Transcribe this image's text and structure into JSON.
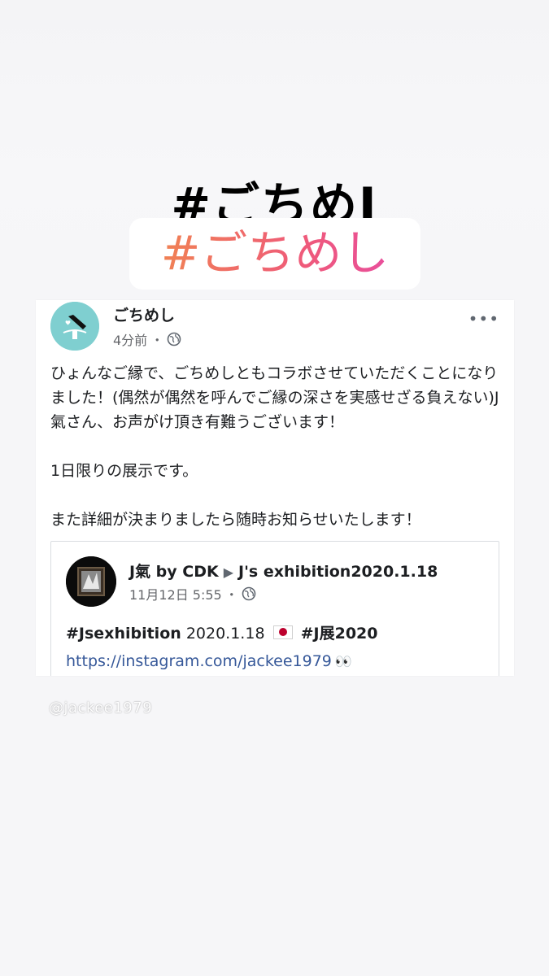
{
  "hashtag_main": "#ごちめJ",
  "hashtag_sub": "#ごちめし",
  "post": {
    "author": "ごちめし",
    "time": "4分前",
    "meta_dot": "・",
    "privacy_icon": "globe-icon",
    "more_label": "•••",
    "body_lines": [
      "ひょんなご縁で、ごちめしともコラボさせていただくことになりました！(偶然が偶然を呼んでご縁の深さを実感せざる負えない)J氣さん、お声がけ頂き有難うございます！",
      "1日限りの展示です。",
      "また詳細が決まりましたら随時お知らせいたします！"
    ],
    "shared": {
      "author": "J氣 by CDK",
      "arrow": "▶",
      "target": "J's exhibition2020.1.18",
      "date": "11月12日 5:55",
      "meta_dot": "・",
      "tag1": "#Jsexhibition",
      "date_text": "2020.1.18",
      "flag_icon": "japan-flag-icon",
      "tag2": "#J展2020",
      "link": "https://instagram.com/jackee1979",
      "eyes": "👀"
    }
  },
  "watermark": "@jackee1979",
  "colors": {
    "hashtag_gradient": [
      "#f08a4b",
      "#ef5a7a",
      "#e64aa8"
    ],
    "avatar_bg": "#7fcfd0",
    "link": "#365899"
  }
}
